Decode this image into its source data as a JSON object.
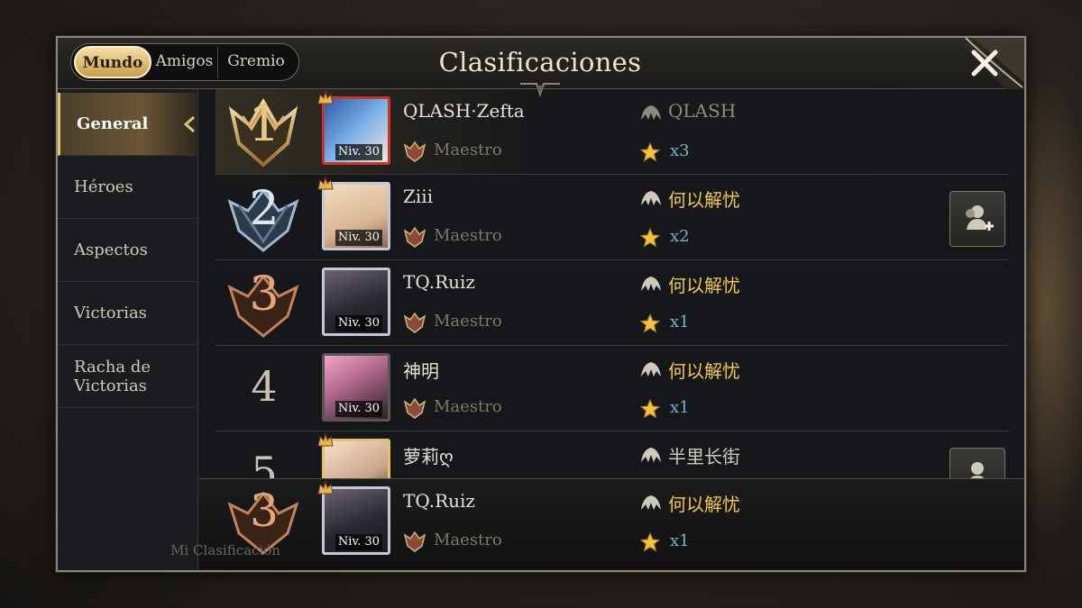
{
  "header": {
    "title": "Clasificaciones",
    "tabs": [
      {
        "label": "Mundo",
        "active": true
      },
      {
        "label": "Amigos",
        "active": false
      },
      {
        "label": "Gremio",
        "active": false
      }
    ]
  },
  "sidebar": {
    "items": [
      {
        "label": "General",
        "active": true
      },
      {
        "label": "Héroes",
        "active": false
      },
      {
        "label": "Aspectos",
        "active": false
      },
      {
        "label": "Victorias",
        "active": false
      },
      {
        "label": "Racha de Victorias",
        "active": false
      }
    ]
  },
  "players": [
    {
      "rank": "1",
      "name": "QLASH·Zefta",
      "level": "Niv. 30",
      "tier": "Maestro",
      "guild": "QLASH",
      "stars": "x3"
    },
    {
      "rank": "2",
      "name": "Ziii",
      "level": "Niv. 30",
      "tier": "Maestro",
      "guild": "何以解忧",
      "stars": "x2"
    },
    {
      "rank": "3",
      "name": "TQ.Ruiz",
      "level": "Niv. 30",
      "tier": "Maestro",
      "guild": "何以解忧",
      "stars": "x1"
    },
    {
      "rank": "4",
      "name": "神明",
      "level": "Niv. 30",
      "tier": "Maestro",
      "guild": "何以解忧",
      "stars": "x1"
    },
    {
      "rank": "5",
      "name": "萝莉ღ",
      "guild": "半里长街"
    }
  ],
  "my_rank": {
    "label": "Mi Clasificación",
    "rank": "3",
    "name": "TQ.Ruiz",
    "level": "Niv. 30",
    "tier": "Maestro",
    "guild": "何以解忧",
    "stars": "x1"
  },
  "colors": {
    "gold_accent": "#e3c27a",
    "guild_gold": "#f2c94c",
    "star_count": "#6fb8c8"
  },
  "icons": [
    "close-icon",
    "add-friend-icon",
    "guild-emblem-icon",
    "star-icon",
    "master-rank-icon",
    "rank-medal-icon"
  ]
}
